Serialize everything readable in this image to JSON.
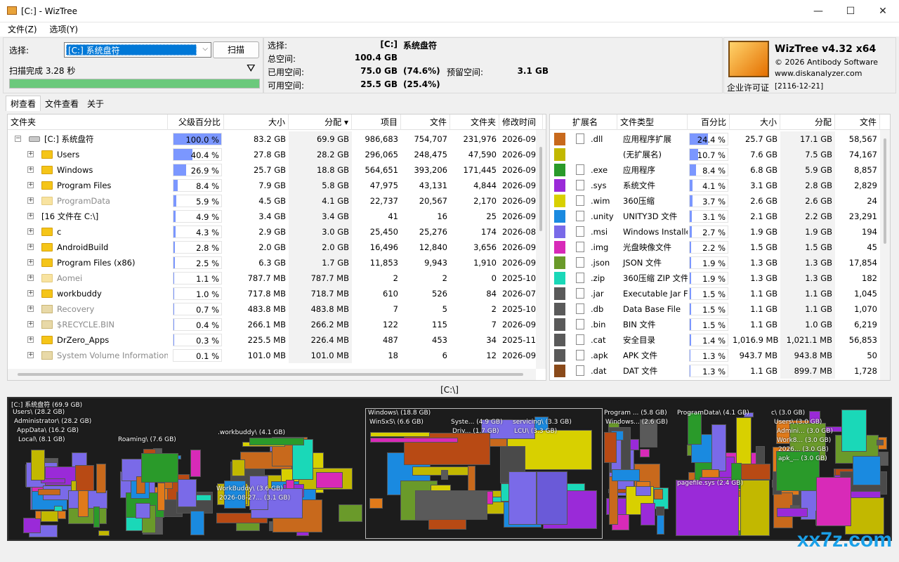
{
  "window": {
    "title": "[C:] - WizTree",
    "minimize": "—",
    "maximize": "☐",
    "close": "✕"
  },
  "menu": [
    "文件(Z)",
    "选项(Y)"
  ],
  "scan": {
    "select_label": "选择:",
    "drive_value": "[C:] 系统盘符",
    "scan_button": "扫描",
    "status": "扫描完成 3.28 秒",
    "progress": 1.0
  },
  "stats": {
    "select_label": "选择:",
    "drive": "[C:]",
    "drive_name": "系统盘符",
    "total_label": "总空间:",
    "total": "100.4 GB",
    "used_label": "已用空间:",
    "used": "75.0 GB",
    "used_pct": "(74.6%)",
    "free_label": "可用空间:",
    "free": "25.5 GB",
    "free_pct": "(25.4%)",
    "reserved_label": "预留空间:",
    "reserved": "3.1 GB"
  },
  "brand": {
    "name": "WizTree v4.32 x64",
    "copyright": "© 2026 Antibody Software",
    "url": "www.diskanalyzer.com",
    "license": "企业许可证",
    "license_date": "[2116-12-21]"
  },
  "tabs": [
    "树查看",
    "文件查看",
    "关于"
  ],
  "tree": {
    "headers": [
      "文件夹",
      "父级百分比",
      "大小",
      "分配",
      "项目",
      "文件",
      "文件夹",
      "修改时间"
    ],
    "rows": [
      {
        "name": "[C:] 系统盘符",
        "pct": "100.0 %",
        "p": 1.0,
        "size": "83.2 GB",
        "alloc": "69.9 GB",
        "items": "986,683",
        "files": "754,707",
        "folders": "231,976",
        "mod": "2026-09",
        "kind": "drive",
        "dim": false
      },
      {
        "name": "Users",
        "pct": "40.4 %",
        "p": 0.404,
        "size": "27.8 GB",
        "alloc": "28.2 GB",
        "items": "296,065",
        "files": "248,475",
        "folders": "47,590",
        "mod": "2026-09",
        "kind": "folder",
        "dim": false
      },
      {
        "name": "Windows",
        "pct": "26.9 %",
        "p": 0.269,
        "size": "25.7 GB",
        "alloc": "18.8 GB",
        "items": "564,651",
        "files": "393,206",
        "folders": "171,445",
        "mod": "2026-09",
        "kind": "folder",
        "dim": false
      },
      {
        "name": "Program Files",
        "pct": "8.4 %",
        "p": 0.084,
        "size": "7.9 GB",
        "alloc": "5.8 GB",
        "items": "47,975",
        "files": "43,131",
        "folders": "4,844",
        "mod": "2026-09",
        "kind": "folder",
        "dim": false
      },
      {
        "name": "ProgramData",
        "pct": "5.9 %",
        "p": 0.059,
        "size": "4.5 GB",
        "alloc": "4.1 GB",
        "items": "22,737",
        "files": "20,567",
        "folders": "2,170",
        "mod": "2026-09",
        "kind": "folder",
        "dim": true
      },
      {
        "name": "[16 文件在 C:\\]",
        "pct": "4.9 %",
        "p": 0.049,
        "size": "3.4 GB",
        "alloc": "3.4 GB",
        "items": "41",
        "files": "16",
        "folders": "25",
        "mod": "2026-09",
        "kind": "none",
        "dim": false
      },
      {
        "name": "c",
        "pct": "4.3 %",
        "p": 0.043,
        "size": "2.9 GB",
        "alloc": "3.0 GB",
        "items": "25,450",
        "files": "25,276",
        "folders": "174",
        "mod": "2026-08",
        "kind": "folder",
        "dim": false
      },
      {
        "name": "AndroidBuild",
        "pct": "2.8 %",
        "p": 0.028,
        "size": "2.0 GB",
        "alloc": "2.0 GB",
        "items": "16,496",
        "files": "12,840",
        "folders": "3,656",
        "mod": "2026-09",
        "kind": "folder",
        "dim": false
      },
      {
        "name": "Program Files (x86)",
        "pct": "2.5 %",
        "p": 0.025,
        "size": "6.3 GB",
        "alloc": "1.7 GB",
        "items": "11,853",
        "files": "9,943",
        "folders": "1,910",
        "mod": "2026-09",
        "kind": "folder",
        "dim": false
      },
      {
        "name": "Aomei",
        "pct": "1.1 %",
        "p": 0.011,
        "size": "787.7 MB",
        "alloc": "787.7 MB",
        "items": "2",
        "files": "2",
        "folders": "0",
        "mod": "2025-10",
        "kind": "folder",
        "dim": true
      },
      {
        "name": "workbuddy",
        "pct": "1.0 %",
        "p": 0.01,
        "size": "717.8 MB",
        "alloc": "718.7 MB",
        "items": "610",
        "files": "526",
        "folders": "84",
        "mod": "2026-07",
        "kind": "folder",
        "dim": false
      },
      {
        "name": "Recovery",
        "pct": "0.7 %",
        "p": 0.007,
        "size": "483.8 MB",
        "alloc": "483.8 MB",
        "items": "7",
        "files": "5",
        "folders": "2",
        "mod": "2025-10",
        "kind": "gear",
        "dim": true
      },
      {
        "name": "$RECYCLE.BIN",
        "pct": "0.4 %",
        "p": 0.004,
        "size": "266.1 MB",
        "alloc": "266.2 MB",
        "items": "122",
        "files": "115",
        "folders": "7",
        "mod": "2026-09",
        "kind": "gear",
        "dim": true
      },
      {
        "name": "DrZero_Apps",
        "pct": "0.3 %",
        "p": 0.003,
        "size": "225.5 MB",
        "alloc": "226.4 MB",
        "items": "487",
        "files": "453",
        "folders": "34",
        "mod": "2025-11",
        "kind": "folder",
        "dim": false
      },
      {
        "name": "System Volume Information",
        "pct": "0.1 %",
        "p": 0.001,
        "size": "101.0 MB",
        "alloc": "101.0 MB",
        "items": "18",
        "files": "6",
        "folders": "12",
        "mod": "2026-09",
        "kind": "gear",
        "dim": true
      }
    ]
  },
  "ext": {
    "headers": [
      "扩展名",
      "文件类型",
      "百分比",
      "大小",
      "分配",
      "文件"
    ],
    "rows": [
      {
        "color": "#c8691c",
        "ext": ".dll",
        "type": "应用程序扩展",
        "pct": "24.4 %",
        "p": 0.244,
        "size": "25.7 GB",
        "alloc": "17.1 GB",
        "files": "58,567"
      },
      {
        "color": "#c2b800",
        "ext": "",
        "type": "(无扩展名)",
        "pct": "10.7 %",
        "p": 0.107,
        "size": "7.6 GB",
        "alloc": "7.5 GB",
        "files": "74,167"
      },
      {
        "color": "#2a9a2a",
        "ext": ".exe",
        "type": "应用程序",
        "pct": "8.4 %",
        "p": 0.084,
        "size": "6.8 GB",
        "alloc": "5.9 GB",
        "files": "8,857"
      },
      {
        "color": "#9a2ad8",
        "ext": ".sys",
        "type": "系统文件",
        "pct": "4.1 %",
        "p": 0.041,
        "size": "3.1 GB",
        "alloc": "2.8 GB",
        "files": "2,829"
      },
      {
        "color": "#d8d000",
        "ext": ".wim",
        "type": "360压缩",
        "pct": "3.7 %",
        "p": 0.037,
        "size": "2.6 GB",
        "alloc": "2.6 GB",
        "files": "24"
      },
      {
        "color": "#1a8ae0",
        "ext": ".unity",
        "type": "UNITY3D 文件",
        "pct": "3.1 %",
        "p": 0.031,
        "size": "2.1 GB",
        "alloc": "2.2 GB",
        "files": "23,291"
      },
      {
        "color": "#7a6ae8",
        "ext": ".msi",
        "type": "Windows Installe",
        "pct": "2.7 %",
        "p": 0.027,
        "size": "1.9 GB",
        "alloc": "1.9 GB",
        "files": "194"
      },
      {
        "color": "#d82ab8",
        "ext": ".img",
        "type": "光盘映像文件",
        "pct": "2.2 %",
        "p": 0.022,
        "size": "1.5 GB",
        "alloc": "1.5 GB",
        "files": "45"
      },
      {
        "color": "#6a9a2a",
        "ext": ".json",
        "type": "JSON 文件",
        "pct": "1.9 %",
        "p": 0.019,
        "size": "1.3 GB",
        "alloc": "1.3 GB",
        "files": "17,854"
      },
      {
        "color": "#1ad8b8",
        "ext": ".zip",
        "type": "360压缩 ZIP 文件",
        "pct": "1.9 %",
        "p": 0.019,
        "size": "1.3 GB",
        "alloc": "1.3 GB",
        "files": "182"
      },
      {
        "color": "#5a5a5a",
        "ext": ".jar",
        "type": "Executable Jar Fi",
        "pct": "1.5 %",
        "p": 0.015,
        "size": "1.1 GB",
        "alloc": "1.1 GB",
        "files": "1,045"
      },
      {
        "color": "#5a5a5a",
        "ext": ".db",
        "type": "Data Base File",
        "pct": "1.5 %",
        "p": 0.015,
        "size": "1.1 GB",
        "alloc": "1.1 GB",
        "files": "1,070"
      },
      {
        "color": "#5a5a5a",
        "ext": ".bin",
        "type": "BIN 文件",
        "pct": "1.5 %",
        "p": 0.015,
        "size": "1.1 GB",
        "alloc": "1.0 GB",
        "files": "6,219"
      },
      {
        "color": "#5a5a5a",
        "ext": ".cat",
        "type": "安全目录",
        "pct": "1.4 %",
        "p": 0.014,
        "size": "1,016.9 MB",
        "alloc": "1,021.1 MB",
        "files": "56,853"
      },
      {
        "color": "#5a5a5a",
        "ext": ".apk",
        "type": "APK 文件",
        "pct": "1.3 %",
        "p": 0.013,
        "size": "943.7 MB",
        "alloc": "943.8 MB",
        "files": "50"
      },
      {
        "color": "#8a4a1a",
        "ext": ".dat",
        "type": "DAT 文件",
        "pct": "1.3 %",
        "p": 0.013,
        "size": "1.1 GB",
        "alloc": "899.7 MB",
        "files": "1,728"
      }
    ]
  },
  "path": "[C:\\]",
  "treemap_labels": [
    "[C:] 系统盘符 (69.9 GB)",
    "Users\\ (28.2 GB)",
    "Administrator\\ (28.2 GB)",
    "AppData\\ (16.2 GB)",
    "Local\\ (8.1 GB)",
    "Roaming\\ (7.6 GB)",
    ".workbuddy\\ (4.1 GB)",
    "WorkBuddy\\ (3.6 GB)",
    "2026-08-27... (3.1 GB)",
    "Windows\\ (18.8 GB)",
    "WinSxS\\ (6.6 GB)",
    "Syste... (4.9 GB)",
    "Driv... (1.7 GB)",
    "servicing\\ (3.3 GB)",
    "LCU\\ (3.3 GB)",
    "Program ... (5.8 GB)",
    "Windows... (2.6 GB)",
    "ProgramData\\ (4.1 GB)",
    "pagefile.sys (2.4 GB)",
    "c\\ (3.0 GB)",
    "Users\\ (3.0 GB)",
    "Admini... (3.0 GB)",
    "Work8... (3.0 GB)",
    "2026... (3.0 GB)",
    "apk_... (3.0 GB)"
  ],
  "watermark": "xx7z.com"
}
